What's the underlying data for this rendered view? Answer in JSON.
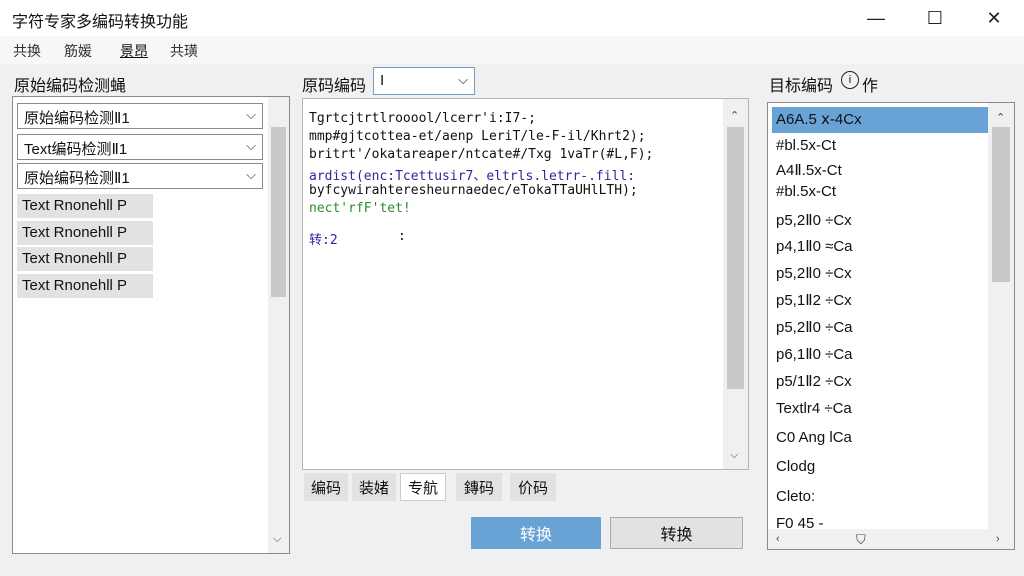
{
  "window": {
    "title": "字符专家多编码转换功能",
    "minimize_glyph": "—",
    "maximize_glyph": "☐",
    "close_glyph": "✕"
  },
  "menu": [
    "共换",
    "筋媛",
    "景昂",
    "共璜"
  ],
  "left": {
    "label": "原始编码检测蝇",
    "combos": [
      "原始编码检测Ⅱ1",
      "Text编码检测Ⅱ1",
      "原始编码检测Ⅱ1"
    ],
    "chips": [
      "Text Rnonehll P",
      "Text Rnonehll P",
      "Text Rnonehll P",
      "Text Rnonehll P"
    ]
  },
  "source": {
    "label": "原码编码",
    "combo_value": "I"
  },
  "editor": {
    "lines": [
      {
        "text": "Tgrtcjtrtlrooool/lcerr'i:I7-;",
        "color": "#111111"
      },
      {
        "text": "mmp#gjtcottea-et/aenp LeriT/le-F-il/Khrt2);",
        "color": "#111111"
      },
      {
        "text": "britrt'/okatareaper/ntcate#/Txg 1vaTr(#L,F);",
        "color": "#111111"
      },
      {
        "text": "ardist(enc:Tcettusir7、eltrls.letrr-.fill:",
        "color": "#2a2a9a"
      },
      {
        "text": "byfcywirahteresheurnaedec/eTokaTTaUHlLTH);",
        "color": "#111111"
      },
      {
        "text": "nect'rfF'tet!",
        "color": "#2e8b2e"
      }
    ],
    "status_left": "转:2",
    "status_right": ":"
  },
  "tabs": [
    "编码",
    "装媎",
    "专航",
    "鏄码",
    "价码"
  ],
  "buttons": {
    "primary": "转换",
    "secondary": "转换"
  },
  "target": {
    "label": "目标编码",
    "extra": "作",
    "items": [
      "A6A.5 ⅹ-4Cx",
      "#bl.5x-Ct",
      "A4Ⅱ.5x-Ct",
      "#bl.5x-Ct",
      "p5,2Ⅱ0 ÷Cx",
      "p4,1Ⅱ0 ≈Ca",
      "p5,2Ⅱ0 ÷Cx",
      "p5,1Ⅱ2 ÷Cx",
      "p5,2Ⅱ0 ÷Ca",
      "p6,1Ⅱ0 ÷Ca",
      "p5/1Ⅱ2 ÷Cx",
      "Textlr4 ÷Ca",
      "C0 Ang lCa",
      "Clodg",
      "Cleto:",
      "F0 45 -"
    ],
    "selected_index": 0
  },
  "colors": {
    "accent": "#69a3d6",
    "code_blue": "#2a2a9a",
    "code_green": "#2e8b2e"
  }
}
